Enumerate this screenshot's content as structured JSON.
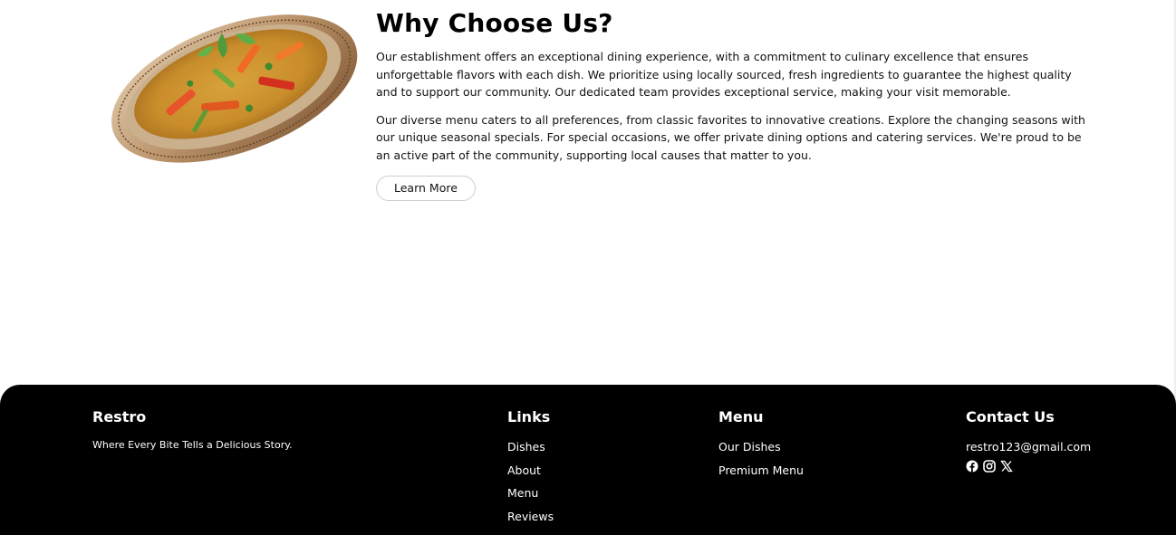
{
  "about": {
    "title": "Why Choose Us?",
    "paragraphs": [
      "Our establishment offers an exceptional dining experience, with a commitment to culinary excellence that ensures unforgettable flavors with each dish. We prioritize using locally sourced, fresh ingredients to guarantee the highest quality and to support our community. Our dedicated team provides exceptional service, making your visit memorable.",
      "Our diverse menu caters to all preferences, from classic favorites to innovative creations. Explore the changing seasons with our unique seasonal specials. For special occasions, we offer private dining options and catering services. We're proud to be an active part of the community, supporting local causes that matter to you."
    ],
    "button_label": "Learn More"
  },
  "footer": {
    "brand": {
      "name": "Restro",
      "tagline": "Where Every Bite Tells a Delicious Story."
    },
    "links": {
      "heading": "Links",
      "items": [
        "Dishes",
        "About",
        "Menu",
        "Reviews"
      ]
    },
    "menu": {
      "heading": "Menu",
      "items": [
        "Our Dishes",
        "Premium Menu"
      ]
    },
    "contact": {
      "heading": "Contact Us",
      "email": "restro123@gmail.com",
      "socials": [
        "facebook-icon",
        "instagram-icon",
        "x-icon"
      ]
    }
  },
  "colors": {
    "footer_bg": "#000000",
    "text": "#111111",
    "button_border": "#cfcfcf"
  }
}
